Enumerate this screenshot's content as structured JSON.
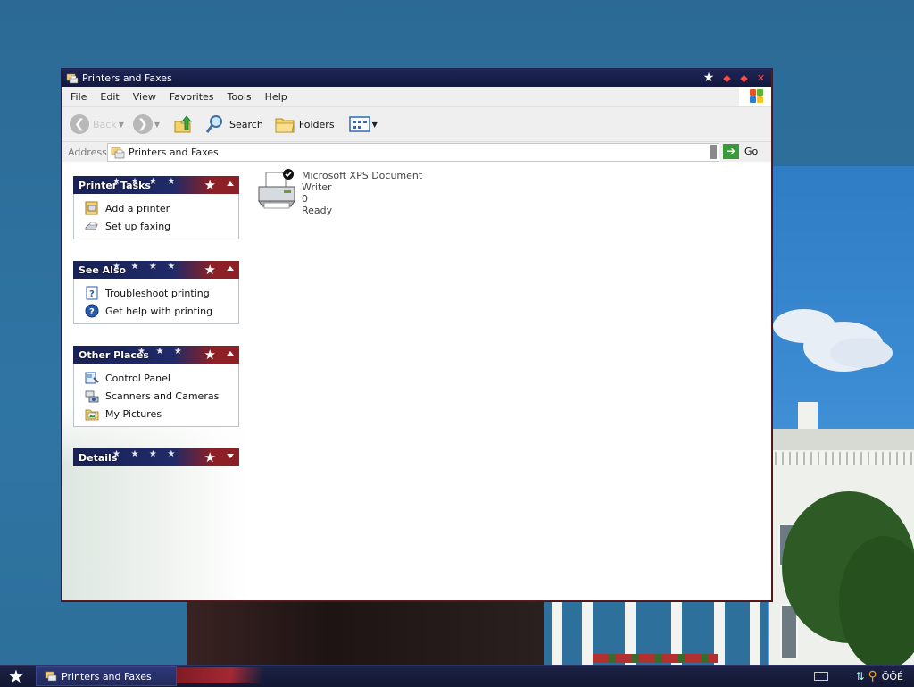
{
  "window": {
    "title": "Printers and Faxes",
    "title_icon": "printers-folder-icon"
  },
  "menubar": {
    "items": [
      "File",
      "Edit",
      "View",
      "Favorites",
      "Tools",
      "Help"
    ]
  },
  "toolbar": {
    "back_label": "Back",
    "search_label": "Search",
    "folders_label": "Folders",
    "views_icon": "views-icon"
  },
  "address": {
    "label": "Address",
    "value": "Printers and Faxes",
    "go_label": "Go"
  },
  "taskpane": {
    "printer_tasks": {
      "title": "Printer Tasks",
      "items": [
        "Add a printer",
        "Set up faxing"
      ]
    },
    "see_also": {
      "title": "See Also",
      "items": [
        "Troubleshoot printing",
        "Get help with printing"
      ]
    },
    "other_places": {
      "title": "Other Places",
      "items": [
        "Control Panel",
        "Scanners and Cameras",
        "My Pictures"
      ]
    },
    "details": {
      "title": "Details"
    }
  },
  "printers": [
    {
      "name": "Microsoft XPS Document Writer",
      "jobs": "0",
      "status": "Ready",
      "is_default": true
    }
  ],
  "taskbar": {
    "active_window": "Printers and Faxes",
    "clock": "ÕÕÉ"
  },
  "colors": {
    "title_bar": "#161d48",
    "panel_header_blue": "#1f2a68",
    "panel_header_red": "#8d1f26",
    "taskbar": "#151a38"
  }
}
